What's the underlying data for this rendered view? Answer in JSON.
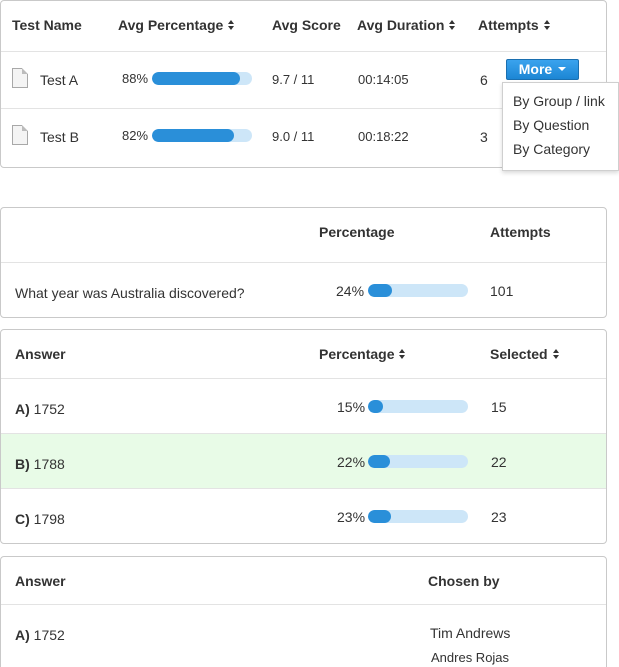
{
  "tests_table": {
    "headers": {
      "name": "Test Name",
      "avg_percentage": "Avg Percentage",
      "avg_score": "Avg Score",
      "avg_duration": "Avg Duration",
      "attempts": "Attempts"
    },
    "rows": [
      {
        "name": "Test A",
        "percentage_label": "88%",
        "percentage": 88,
        "score": "9.7 / 11",
        "duration": "00:14:05",
        "attempts": "6"
      },
      {
        "name": "Test B",
        "percentage_label": "82%",
        "percentage": 82,
        "score": "9.0 / 11",
        "duration": "00:18:22",
        "attempts": "3"
      }
    ],
    "more_button": "More",
    "dropdown": [
      "By Group / link",
      "By Question",
      "By Category"
    ]
  },
  "question_table": {
    "headers": {
      "percentage": "Percentage",
      "attempts": "Attempts"
    },
    "row": {
      "question": "What year was Australia discovered?",
      "percentage_label": "24%",
      "percentage": 24,
      "attempts": "101"
    }
  },
  "answers_table": {
    "headers": {
      "answer": "Answer",
      "percentage": "Percentage",
      "selected": "Selected"
    },
    "rows": [
      {
        "letter": "A)",
        "answer": "1752",
        "percentage_label": "15%",
        "percentage": 15,
        "selected": "15",
        "highlighted": false
      },
      {
        "letter": "B)",
        "answer": "1788",
        "percentage_label": "22%",
        "percentage": 22,
        "selected": "22",
        "highlighted": true
      },
      {
        "letter": "C)",
        "answer": "1798",
        "percentage_label": "23%",
        "percentage": 23,
        "selected": "23",
        "highlighted": false
      }
    ],
    "highlight_color": "#e8fbe7"
  },
  "chosen_table": {
    "headers": {
      "answer": "Answer",
      "chosen_by": "Chosen by"
    },
    "row": {
      "letter": "A)",
      "answer": "1752",
      "chosen_by": [
        "Tim Andrews",
        "Andres Rojas"
      ]
    }
  },
  "colors": {
    "bar_fill": "#2a8fd9",
    "bar_track": "#cde6f8",
    "button": "#1c86d4"
  }
}
